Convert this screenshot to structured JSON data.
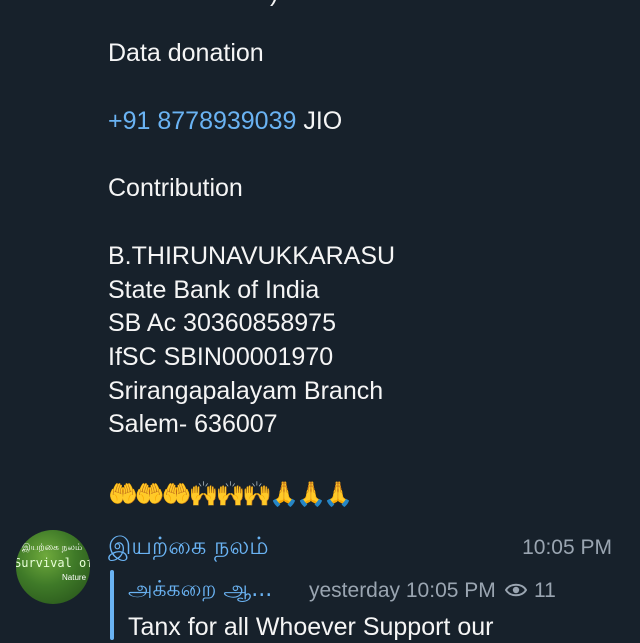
{
  "message": {
    "lines": [
      "Data donation",
      "+91 8778939039",
      " JIO",
      "Contribution",
      "B.THIRUNAVUKKARASU",
      "State Bank of India",
      "SB Ac 30360858975",
      "IfSC SBIN00001970",
      "Srirangapalayam Branch",
      "Salem- 636007"
    ],
    "emojis": "🤲🤲🤲🙌🙌🙌🙏🙏🙏"
  },
  "post": {
    "avatar": {
      "line1": "இயற்கை நலம்",
      "line2": "Survival of",
      "line3": "Nature"
    },
    "sender_name": "இயற்கை நலம்",
    "time": "10:05 PM",
    "reply": {
      "name": "அக்கறை ஆ...",
      "time": "yesterday 10:05 PM",
      "views": "11",
      "text": "Tanx for all Whoever Support our"
    }
  },
  "colors": {
    "background": "#17212b",
    "link": "#6ab3f3",
    "meta": "#9aa5b1"
  }
}
